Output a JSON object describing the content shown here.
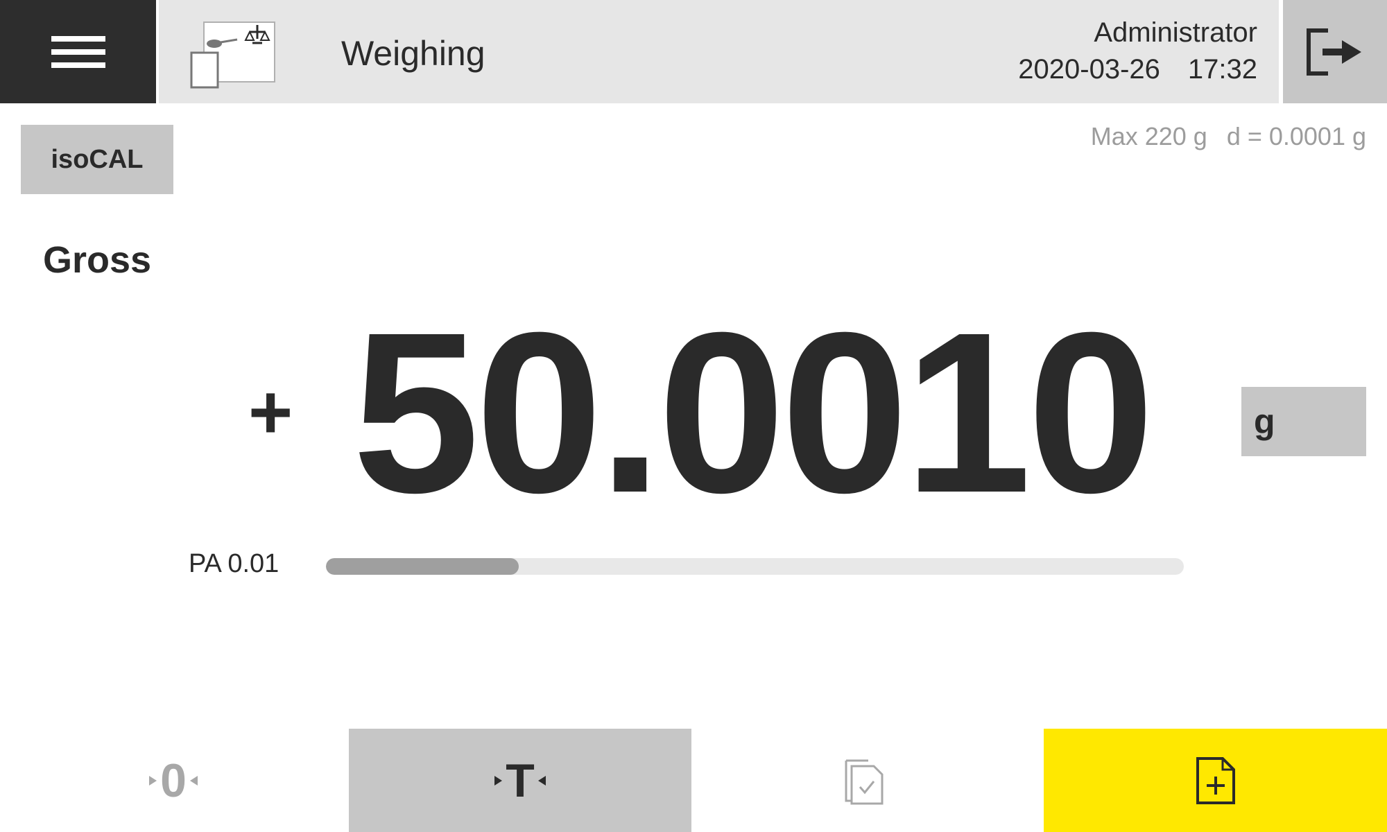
{
  "header": {
    "menu_icon": "hamburger-menu-icon",
    "app_icon": "weighing-app-icon",
    "app_title": "Weighing",
    "user": "Administrator",
    "date": "2020-03-26",
    "time": "17:32",
    "logout_icon": "logout-icon"
  },
  "main": {
    "isocal_label": "isoCAL",
    "capacity_max": "Max 220 g",
    "readability": "d = 0.0001 g",
    "mode_label": "Gross",
    "sign": "+",
    "weight": "50.0010",
    "unit": "g",
    "pa_label": "PA 0.01",
    "pa_progress": 0.225
  },
  "actions": {
    "zero_label": "0",
    "tare_label": "T",
    "results_icon": "documents-check-icon",
    "new_icon": "new-document-icon",
    "accent_color": "#ffe800"
  }
}
